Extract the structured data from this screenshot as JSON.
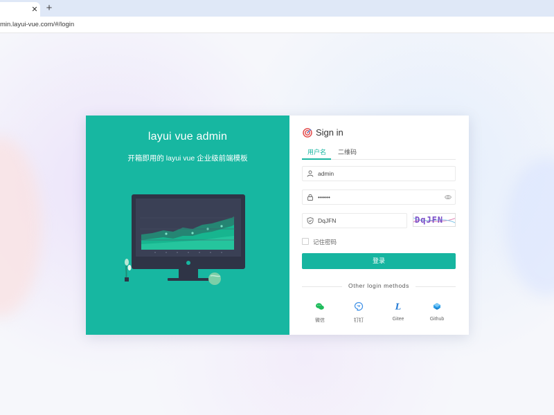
{
  "browser": {
    "close_tab_glyph": "✕",
    "new_tab_glyph": "+",
    "url": "min.layui-vue.com/#/login"
  },
  "brand": {
    "title": "layui vue admin",
    "subtitle": "开箱即用的 layui vue 企业级前端模板"
  },
  "login": {
    "title": "Sign in",
    "tabs": [
      {
        "label": "用户名",
        "active": true
      },
      {
        "label": "二维码",
        "active": false
      }
    ],
    "username_value": "admin",
    "password_value": "••••••",
    "captcha_value": "DqJFN",
    "captcha_image_text": "DqJFN",
    "remember_label": "记住密码",
    "submit_label": "登录",
    "other_methods_label": "Other login methods",
    "methods": [
      {
        "label": "微信",
        "icon": "wechat-icon"
      },
      {
        "label": "钉钉",
        "icon": "dingtalk-icon"
      },
      {
        "label": "Gitee",
        "icon": "gitee-icon"
      },
      {
        "label": "Github",
        "icon": "github-icon"
      }
    ]
  },
  "colors": {
    "primary": "#16b5a0",
    "brand_panel": "#17b7a1",
    "monitor": "#2f3446"
  }
}
